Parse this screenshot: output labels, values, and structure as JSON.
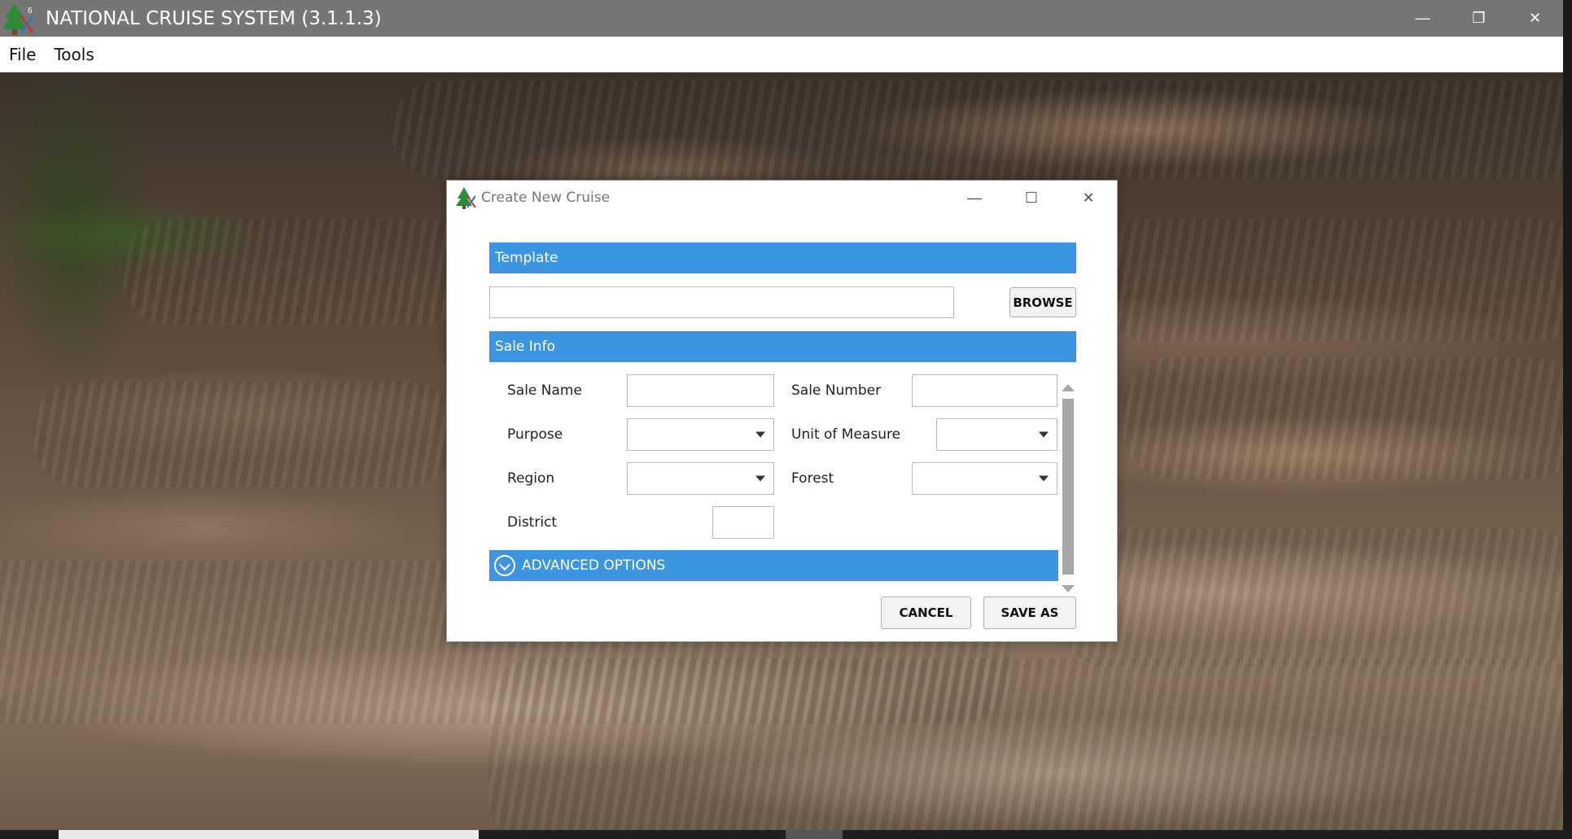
{
  "window": {
    "title": "NATIONAL CRUISE SYSTEM (3.1.1.3)",
    "controls": {
      "minimize": "—",
      "restore": "❐",
      "close": "✕"
    }
  },
  "menu": {
    "items": [
      "File",
      "Tools"
    ]
  },
  "dialog": {
    "title": "Create New Cruise",
    "controls": {
      "minimize": "—",
      "maximize": "☐",
      "close": "✕"
    },
    "template": {
      "header": "Template",
      "path_value": "",
      "browse_label": "BROWSE"
    },
    "sale_info": {
      "header": "Sale Info",
      "sale_name_label": "Sale Name",
      "sale_name_value": "",
      "sale_number_label": "Sale Number",
      "sale_number_value": "",
      "purpose_label": "Purpose",
      "purpose_value": "",
      "uom_label": "Unit of Measure",
      "uom_value": "",
      "region_label": "Region",
      "region_value": "",
      "forest_label": "Forest",
      "forest_value": "",
      "district_label": "District",
      "district_value": ""
    },
    "advanced_options_label": "ADVANCED OPTIONS",
    "cancel_label": "CANCEL",
    "save_as_label": "SAVE AS"
  },
  "colors": {
    "accent": "#3b95e0",
    "titlebar": "#767676"
  }
}
